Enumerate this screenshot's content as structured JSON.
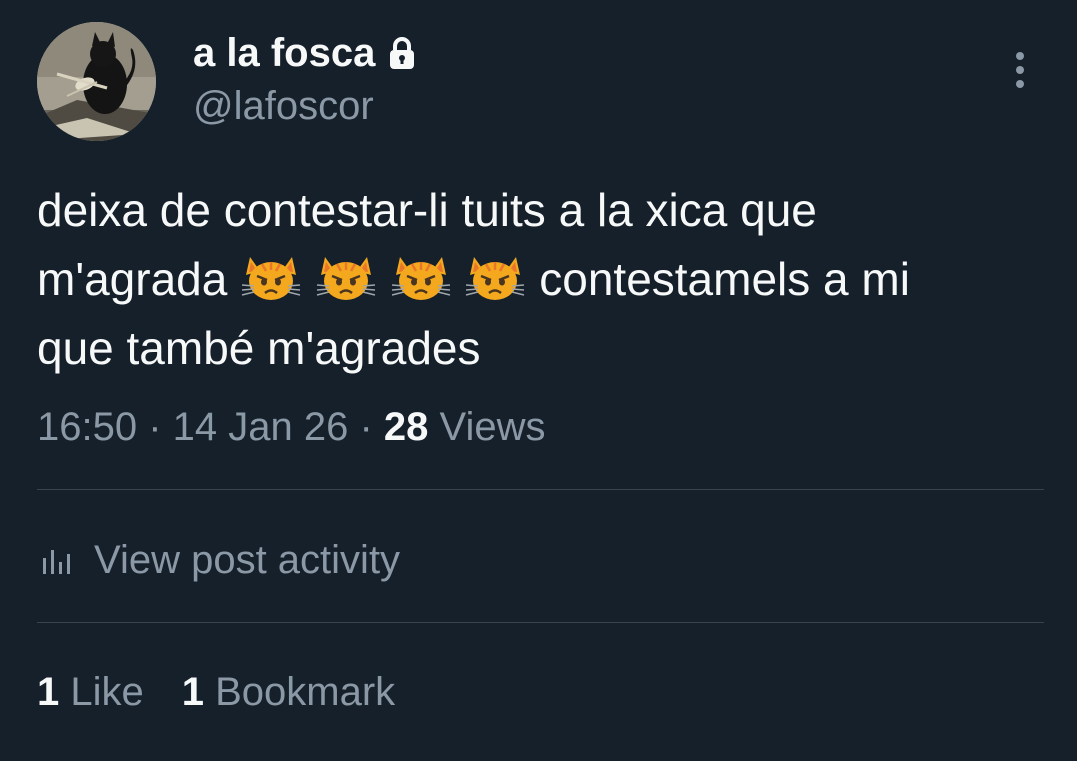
{
  "author": {
    "display_name": "a la fosca",
    "handle": "@lafoscor",
    "avatar_icon": "black-cat-avatar",
    "protected_icon": "lock-icon"
  },
  "tweet": {
    "line1": "deixa de contestar-li tuits a la xica que",
    "line2_start": "m'agrada",
    "emoji": [
      "😾",
      "😾",
      "😾",
      "😾"
    ],
    "line2_end": " contestamels a mi",
    "line3": "que també m'agrades"
  },
  "meta": {
    "time": "16:50",
    "separator": " · ",
    "date": "14 Jan 26",
    "views_count": "28",
    "views_label": " Views"
  },
  "activity": {
    "label": "View post activity",
    "icon": "bar-chart-icon"
  },
  "stats": {
    "likes_count": "1",
    "likes_label": " Like",
    "bookmarks_count": "1",
    "bookmarks_label": " Bookmark"
  },
  "colors": {
    "background": "#15202b",
    "primary_text": "#f7f9f9",
    "secondary_text": "#8b98a5",
    "divider": "#38444d"
  }
}
